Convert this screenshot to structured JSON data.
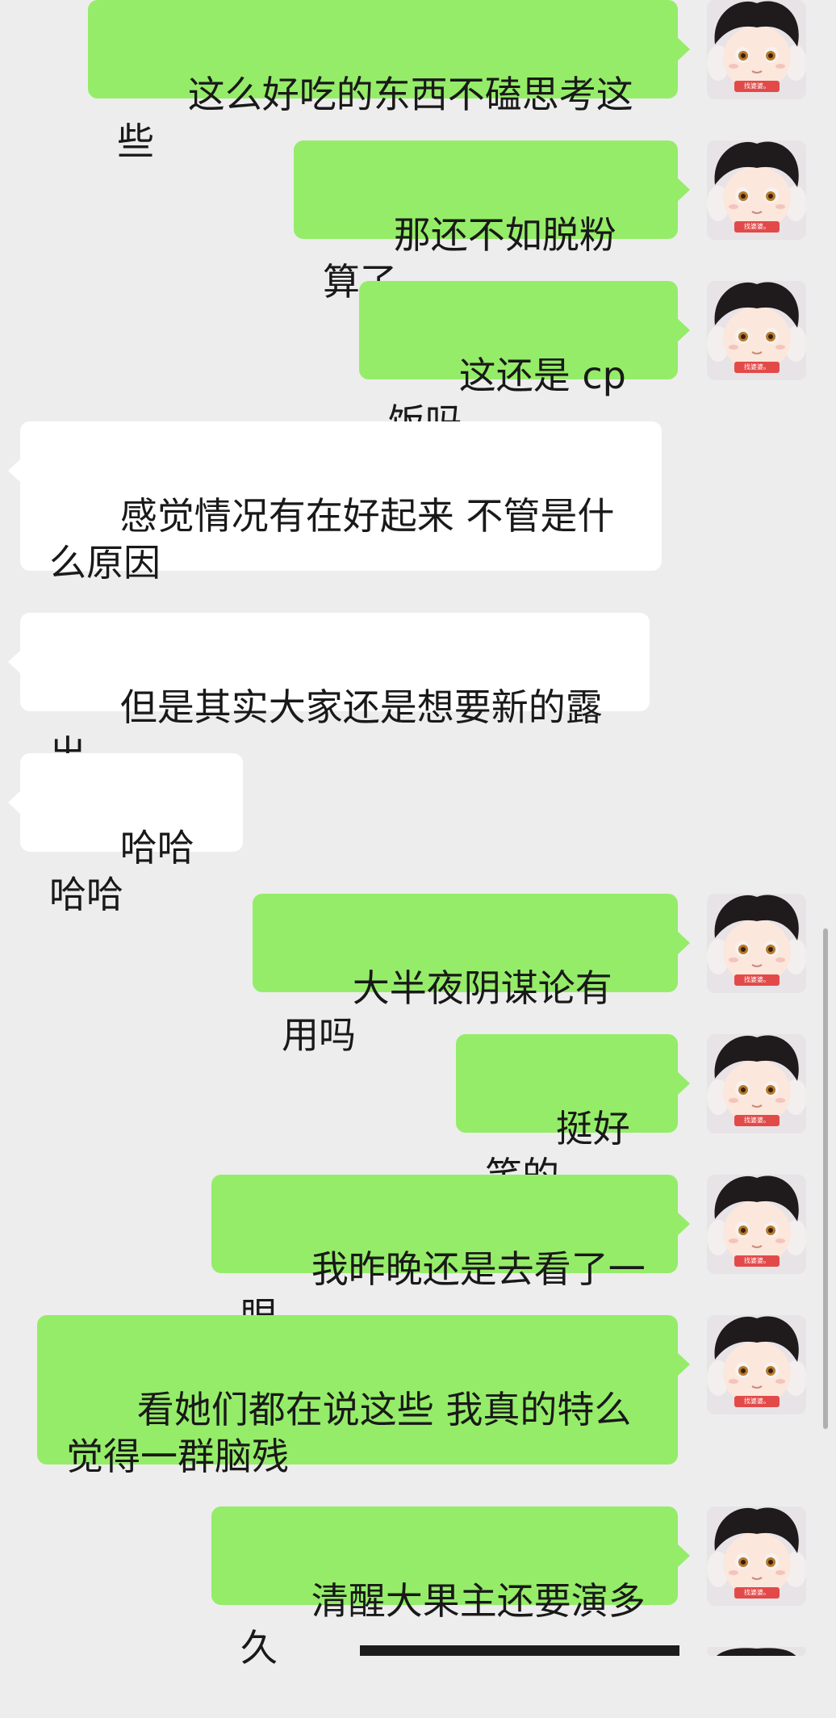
{
  "chat": {
    "messages": [
      {
        "side": "out",
        "text": "这么好吃的东西不磕思考这些"
      },
      {
        "side": "out",
        "text": "那还不如脱粉算了"
      },
      {
        "side": "out",
        "text": "这还是 cp 饭吗"
      },
      {
        "side": "in",
        "text": "感觉情况有在好起来 不管是什么原因"
      },
      {
        "side": "in",
        "text": "但是其实大家还是想要新的露出"
      },
      {
        "side": "in",
        "text": "哈哈哈哈"
      },
      {
        "side": "out",
        "text": "大半夜阴谋论有用吗"
      },
      {
        "side": "out",
        "text": "挺好笑的"
      },
      {
        "side": "out",
        "text": "我昨晚还是去看了一眼"
      },
      {
        "side": "out",
        "text": "看她们都在说这些 我真的特么觉得一群脑残"
      },
      {
        "side": "out",
        "text": "清醒大果主还要演多久"
      }
    ],
    "avatar": {
      "icon": "plush-doll-avatar",
      "badge_text": "找婆婆。"
    }
  },
  "colors": {
    "outgoing_bubble": "#95ec69",
    "incoming_bubble": "#ffffff",
    "background": "#ededed"
  }
}
